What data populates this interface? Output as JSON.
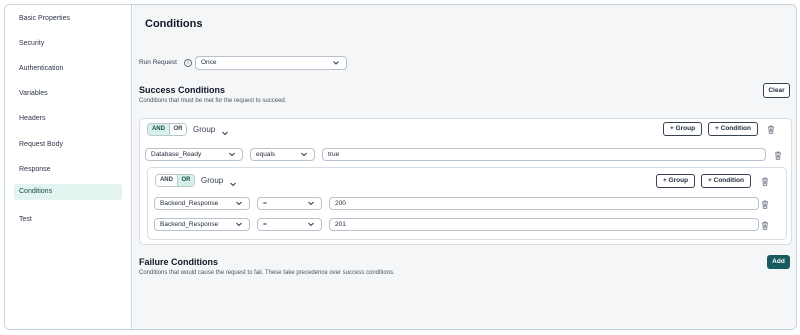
{
  "sidebar": {
    "items": [
      {
        "label": "Basic Properties"
      },
      {
        "label": "Security"
      },
      {
        "label": "Authentication"
      },
      {
        "label": "Variables"
      },
      {
        "label": "Headers"
      },
      {
        "label": "Request Body"
      },
      {
        "label": "Response"
      },
      {
        "label": "Conditions",
        "active": true
      },
      {
        "label": "Test"
      }
    ]
  },
  "main": {
    "title": "Conditions",
    "run_request": {
      "label": "Run Request",
      "info_icon": "info-icon",
      "value": "Once"
    },
    "success": {
      "title": "Success Conditions",
      "subtitle": "Conditions that must be met for the request to succeed.",
      "clear_label": "Clear",
      "group": {
        "and_label": "AND",
        "or_label": "OR",
        "selected": "AND",
        "group_label": "Group",
        "add_group_label": "+ Group",
        "add_condition_label": "+ Condition",
        "condition": {
          "field": "Database_Ready",
          "operator": "equals",
          "value": "true"
        },
        "nested": {
          "and_label": "AND",
          "or_label": "OR",
          "selected": "OR",
          "group_label": "Group",
          "add_group_label": "+ Group",
          "add_condition_label": "+ Condition",
          "conditions": [
            {
              "field": "Backend_Response",
              "operator": "=",
              "value": "200"
            },
            {
              "field": "Backend_Response",
              "operator": "=",
              "value": "201"
            }
          ]
        }
      }
    },
    "failure": {
      "title": "Failure Conditions",
      "subtitle": "Conditions that would cause the request to fail. These take precedence over success conditions.",
      "add_label": "Add"
    }
  },
  "colors": {
    "accent": "#185b5e",
    "active_bg": "#e3f3ef",
    "toggle_on": "#d8f0eb"
  }
}
